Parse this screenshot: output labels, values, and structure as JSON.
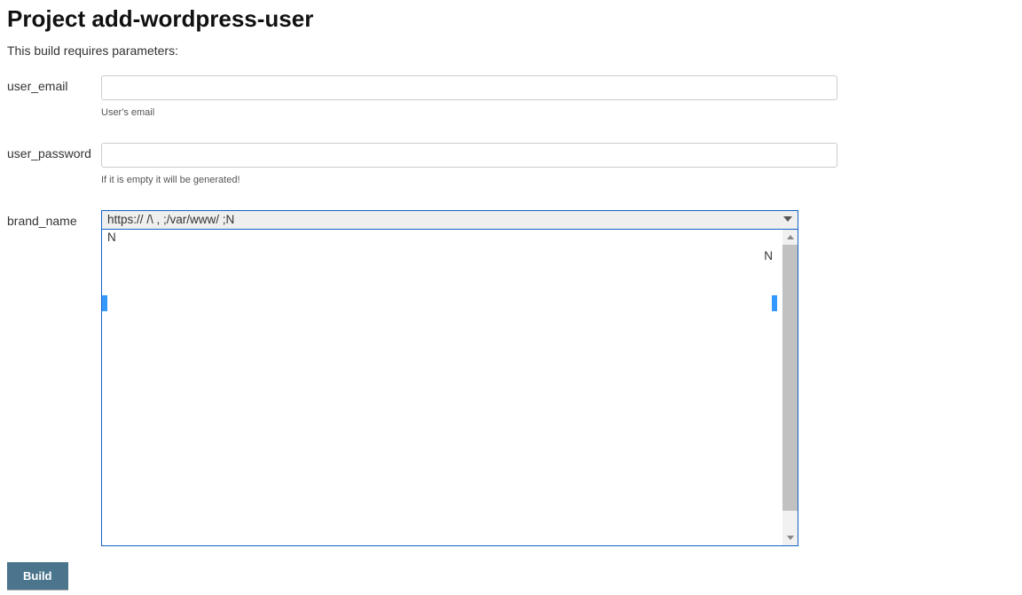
{
  "page": {
    "title": "Project add-wordpress-user",
    "subtitle": "This build requires parameters:"
  },
  "params": {
    "user_email": {
      "label": "user_email",
      "value": "",
      "help": "User's email"
    },
    "user_password": {
      "label": "user_password",
      "value": "",
      "help": "If it is empty it will be generated!"
    },
    "brand_name": {
      "label": "brand_name",
      "selected_display": "https://                                       /\\  ,                                          ;/var/www/                                            ;N",
      "dropdown_visible_lines": [
        "                                                                                                                                                                                                                    N",
        "",
        "",
        ""
      ]
    }
  },
  "buttons": {
    "build": "Build"
  },
  "colors": {
    "button_bg": "#4b758d",
    "focus_border": "#1561c8",
    "selection_bg": "#3399ff"
  }
}
